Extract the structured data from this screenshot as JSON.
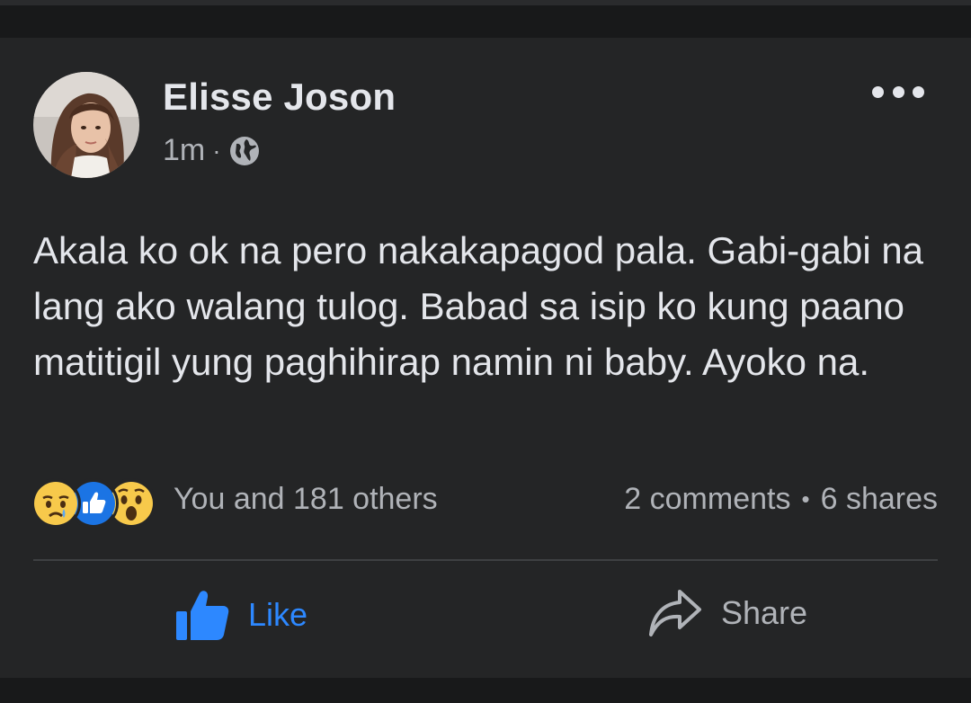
{
  "post": {
    "author": "Elisse Joson",
    "time": "1m",
    "separator": "·",
    "privacy_icon": "globe-icon",
    "more_icon": "more-options-icon",
    "text": "Akala ko ok na pero nakakapagod pala. Gabi-gabi na lang ako walang tulog. Babad sa isip ko kung paano matitigil yung paghihirap namin ni baby. Ayoko na.",
    "reactions": [
      "sad-reaction-icon",
      "like-reaction-icon",
      "wow-reaction-icon"
    ],
    "reaction_summary": "You and 181 others",
    "comments": "2 comments",
    "stats_separator": "•",
    "shares": "6 shares"
  },
  "actions": {
    "like_label": "Like",
    "share_label": "Share"
  },
  "colors": {
    "background": "#18191a",
    "card": "#242526",
    "primary_text": "#e4e6eb",
    "secondary_text": "#b0b3b8",
    "accent": "#2d88ff"
  }
}
